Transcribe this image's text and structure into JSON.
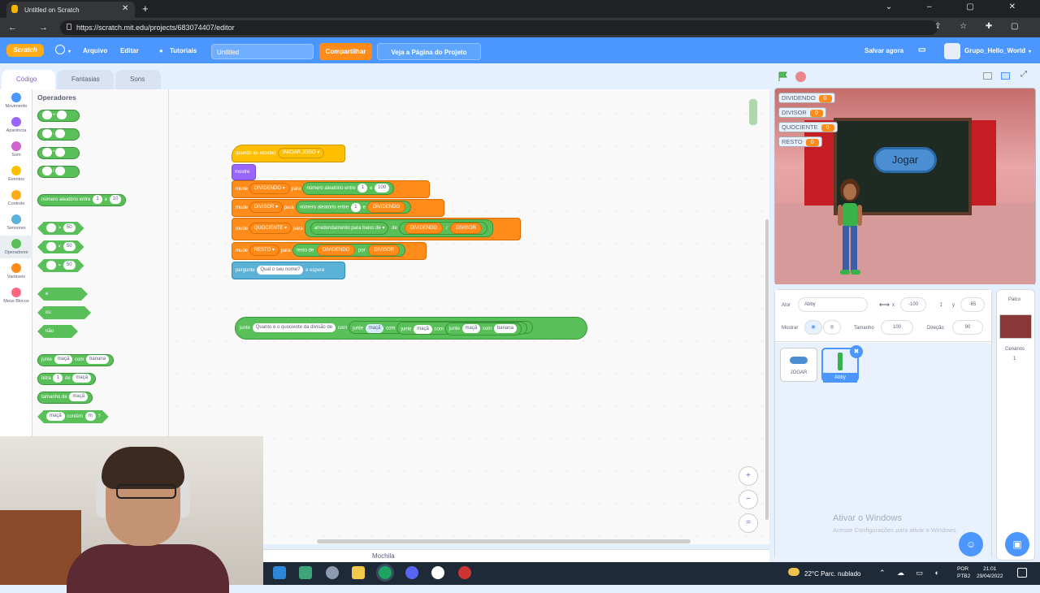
{
  "browser": {
    "tab_title": "Untitled on Scratch",
    "url": "https://scratch.mit.edu/projects/683074407/editor",
    "nav": "←  →  ⟳",
    "extras": "⇪ ☆ ✚ ▢"
  },
  "menu": {
    "logo": "Scratch",
    "file": "Arquivo",
    "edit": "Editar",
    "tutorials": "Tutoriais",
    "title": "Untitled",
    "share": "Compartilhar",
    "see_project": "Veja a Página do Projeto",
    "save": "Salvar agora",
    "user": "Grupo_Hello_World"
  },
  "tabs": {
    "code": "Código",
    "costumes": "Fantasias",
    "sounds": "Sons"
  },
  "categories": [
    {
      "label": "Movimento",
      "color": "#4c97ff"
    },
    {
      "label": "Aparência",
      "color": "#9966ff"
    },
    {
      "label": "Som",
      "color": "#cf63cf"
    },
    {
      "label": "Eventos",
      "color": "#ffbf00"
    },
    {
      "label": "Controle",
      "color": "#ffab19"
    },
    {
      "label": "Sensores",
      "color": "#5cb1d6"
    },
    {
      "label": "Operadores",
      "color": "#59c059"
    },
    {
      "label": "Variáveis",
      "color": "#ff8c1a"
    },
    {
      "label": "Meus Blocos",
      "color": "#ff6680"
    }
  ],
  "palette": {
    "title": "Operadores",
    "ops": [
      "+",
      "-",
      "*",
      "/"
    ],
    "random": {
      "a": "número aleatório entre",
      "v1": "1",
      "b": "e",
      "v2": "10"
    },
    "cmp": [
      {
        "op": ">",
        "v": "50"
      },
      {
        "op": "<",
        "v": "50"
      },
      {
        "op": "=",
        "v": "50"
      }
    ],
    "bool": {
      "and": "e",
      "or": "ou",
      "not": "não"
    },
    "join": {
      "a": "junte",
      "v1": "maçã",
      "b": "com",
      "v2": "banana"
    },
    "letter": {
      "a": "letra",
      "v1": "1",
      "b": "de",
      "v2": "maçã"
    },
    "length": {
      "a": "tamanho de",
      "v1": "maçã"
    },
    "contains": {
      "v1": "maçã",
      "a": "contém",
      "v2": "m",
      "q": "?"
    }
  },
  "script": {
    "hat": {
      "a": "quando eu receber",
      "v": "INICIAR JOGO ▾"
    },
    "show": "mostre",
    "set1": {
      "a": "mude",
      "var": "DIVIDENDO ▾",
      "b": "para",
      "r": "número aleatório entre",
      "v1": "1",
      "e": "e",
      "v2": "100"
    },
    "set2": {
      "a": "mude",
      "var": "DIVISOR ▾",
      "b": "para",
      "r": "número aleatório entre",
      "v1": "1",
      "e": "e",
      "v2": "DIVIDENDO"
    },
    "set3": {
      "a": "mude",
      "var": "QUOCIENTE ▾",
      "b": "para",
      "r": "arredondamento para baixo de ▾",
      "de": "de",
      "v1": "DIVIDENDO",
      "slash": "/",
      "v2": "DIVISOR"
    },
    "set4": {
      "a": "mude",
      "var": "RESTO ▾",
      "b": "para",
      "r": "resto de",
      "v1": "DIVIDENDO",
      "por": "por",
      "v2": "DIVISOR"
    },
    "ask": {
      "a": "pergunte",
      "v": "Qual o seu nome?",
      "b": "e espere"
    },
    "join": {
      "a": "junte",
      "v1": "Quanto é o quociente da divisão de",
      "c1": "com",
      "j2": "junte",
      "v2": "maçã",
      "c2": "com",
      "j3": "junte",
      "v3": "maçã",
      "c3": "com",
      "j4": "junte",
      "v4": "maçã",
      "c4": "com",
      "v5": "banana"
    }
  },
  "backpack": "Mochila",
  "monitors": [
    {
      "name": "DIVIDENDO",
      "value": "0"
    },
    {
      "name": "DIVISOR",
      "value": "0"
    },
    {
      "name": "QUOCIENTE",
      "value": "0"
    },
    {
      "name": "RESTO",
      "value": "0"
    }
  ],
  "stage": {
    "button": "Jogar"
  },
  "sprite": {
    "ator_label": "Ator",
    "name": "Abby",
    "x_label": "x",
    "x": "-100",
    "y_label": "y",
    "y": "-65",
    "show_label": "Mostrar",
    "size_label": "Tamanho",
    "size": "100",
    "dir_label": "Direção",
    "dir": "90"
  },
  "sprites": [
    {
      "name": "JOGAR"
    },
    {
      "name": "Abby"
    }
  ],
  "stage_pane": {
    "title": "Palco",
    "backdrops_label": "Cenários",
    "backdrops": "1"
  },
  "watermark": {
    "title": "Ativar o Windows",
    "sub": "Acesse Configurações para ativar o Windows."
  },
  "taskbar": {
    "weather": "22°C  Parc. nublado",
    "lang1": "POR",
    "lang2": "PTB2",
    "time": "21:01",
    "date": "29/04/2022"
  }
}
